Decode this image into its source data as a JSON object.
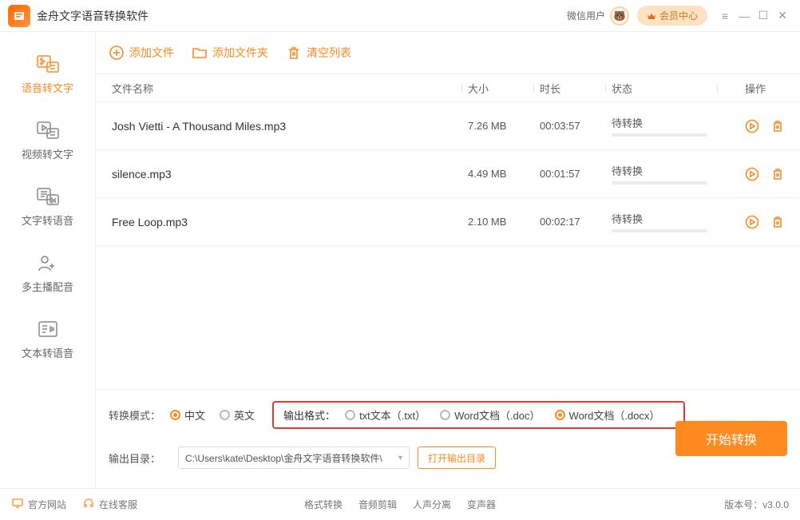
{
  "app": {
    "title": "金舟文字语音转换软件"
  },
  "titlebar": {
    "wechat_user": "微信用户",
    "member_center": "会员中心"
  },
  "sidebar": {
    "items": [
      {
        "label": "语音转文字"
      },
      {
        "label": "视频转文字"
      },
      {
        "label": "文字转语音"
      },
      {
        "label": "多主播配音"
      },
      {
        "label": "文本转语音"
      }
    ]
  },
  "toolbar": {
    "add_file": "添加文件",
    "add_folder": "添加文件夹",
    "clear_list": "清空列表"
  },
  "columns": {
    "name": "文件名称",
    "size": "大小",
    "duration": "时长",
    "status": "状态",
    "op": "操作"
  },
  "files": [
    {
      "name": "Josh Vietti - A Thousand Miles.mp3",
      "size": "7.26 MB",
      "duration": "00:03:57",
      "status": "待转换"
    },
    {
      "name": "silence.mp3",
      "size": "4.49 MB",
      "duration": "00:01:57",
      "status": "待转换"
    },
    {
      "name": "Free Loop.mp3",
      "size": "2.10 MB",
      "duration": "00:02:17",
      "status": "待转换"
    }
  ],
  "options": {
    "mode_label": "转换模式：",
    "mode_cn": "中文",
    "mode_en": "英文",
    "format_label": "输出格式：",
    "fmt_txt": "txt文本（.txt）",
    "fmt_doc": "Word文档（.doc）",
    "fmt_docx": "Word文档（.docx）",
    "output_label": "输出目录：",
    "output_path": "C:\\Users\\kate\\Desktop\\金舟文字语音转换软件\\",
    "open_output": "打开输出目录",
    "start": "开始转换"
  },
  "footer": {
    "official_site": "官方网站",
    "online_service": "在线客服",
    "links": [
      "格式转换",
      "音频剪辑",
      "人声分离",
      "变声器"
    ],
    "version_label": "版本号：",
    "version": "v3.0.0"
  }
}
